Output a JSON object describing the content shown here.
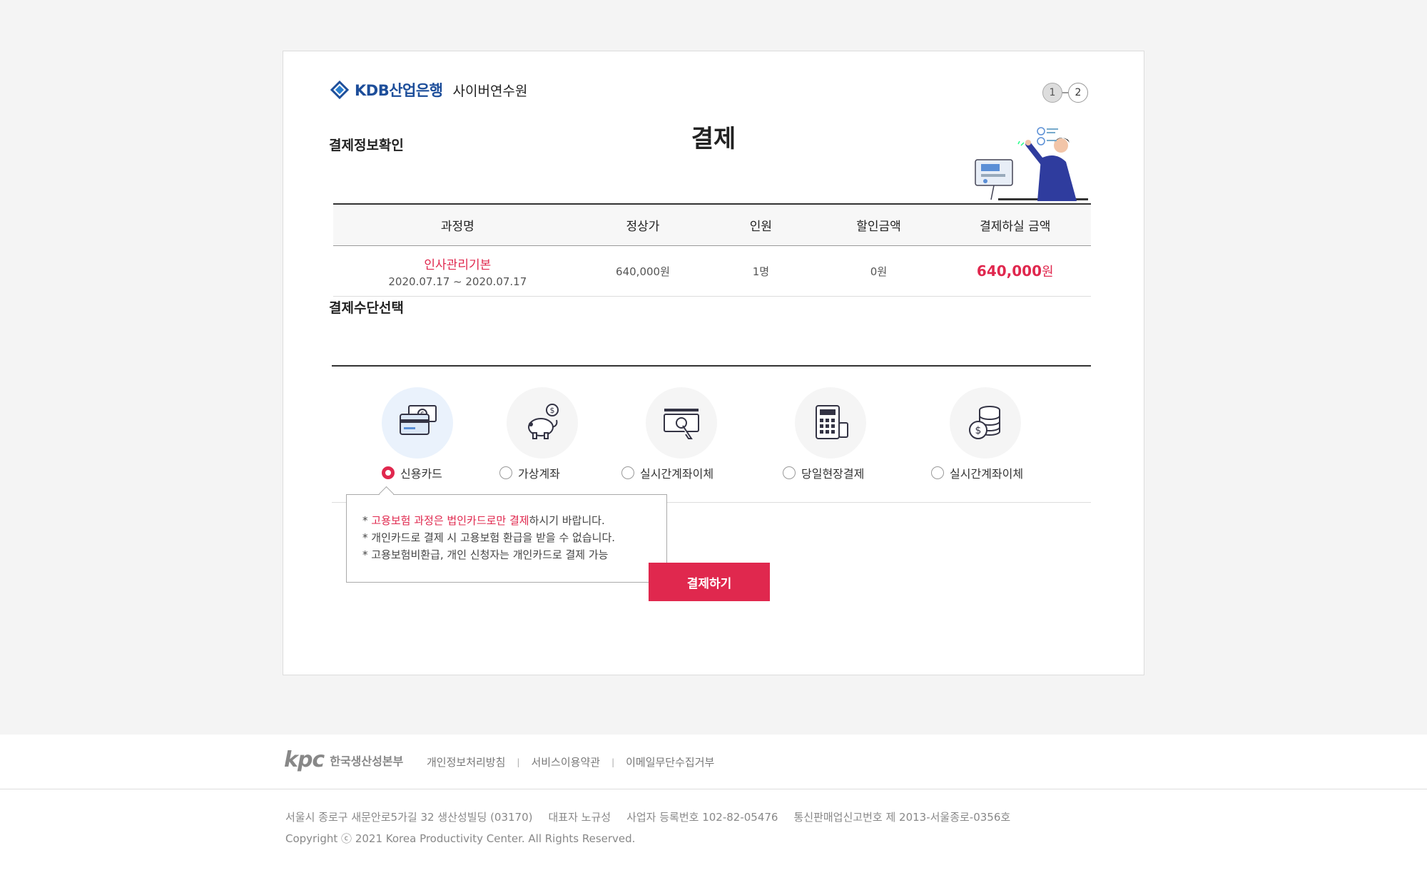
{
  "header": {
    "brand": "KDB산업은행",
    "service": "사이버연수원",
    "steps": [
      "1",
      "2"
    ]
  },
  "page_title": "결제",
  "payment_info": {
    "section_title": "결제정보확인",
    "columns": [
      "과정명",
      "정상가",
      "인원",
      "할인금액",
      "결제하실 금액"
    ],
    "row": {
      "course_name": "인사관리기본",
      "course_period": "2020.07.17 ~ 2020.07.17",
      "price": "640,000원",
      "people": "1명",
      "discount": "0원",
      "total": "640,000",
      "total_unit": "원"
    }
  },
  "payment_method": {
    "section_title": "결제수단선택",
    "methods": [
      {
        "label": "신용카드",
        "selected": true,
        "icon": "credit-card-icon"
      },
      {
        "label": "가상계좌",
        "selected": false,
        "icon": "piggy-bank-icon"
      },
      {
        "label": "실시간계좌이체",
        "selected": false,
        "icon": "cash-transfer-icon"
      },
      {
        "label": "당일현장결제",
        "selected": false,
        "icon": "calculator-icon"
      },
      {
        "label": "실시간계좌이체",
        "selected": false,
        "icon": "coins-icon"
      }
    ],
    "notice": {
      "line1_prefix": "* ",
      "line1_highlight": "고용보험 과정은 법인카드로만 결제",
      "line1_suffix": "하시기 바랍니다.",
      "line2": "* 개인카드로 결제 시 고용보험 환급을 받을 수 없습니다.",
      "line3": "* 고용보험비환급, 개인 신청자는 개인카드로 결제 가능"
    }
  },
  "pay_button": "결제하기",
  "footer": {
    "org_logo": "kpc",
    "org_name": "한국생산성본부",
    "links": [
      "개인정보처리방침",
      "서비스이용약관",
      "이메일무단수집거부"
    ],
    "address": "서울시 종로구 새문안로5가길 32 생산성빌딩 (03170)",
    "ceo": "대표자 노규성",
    "biz_no": "사업자 등록번호 102-82-05476",
    "ecommerce_no": "통신판매업신고번호 제 2013-서울종로-0356호",
    "copyright": "Copyright ⓒ 2021 Korea Productivity Center. All Rights Reserved."
  },
  "colors": {
    "accent": "#e0284e",
    "brand_blue": "#1d4e9a"
  }
}
